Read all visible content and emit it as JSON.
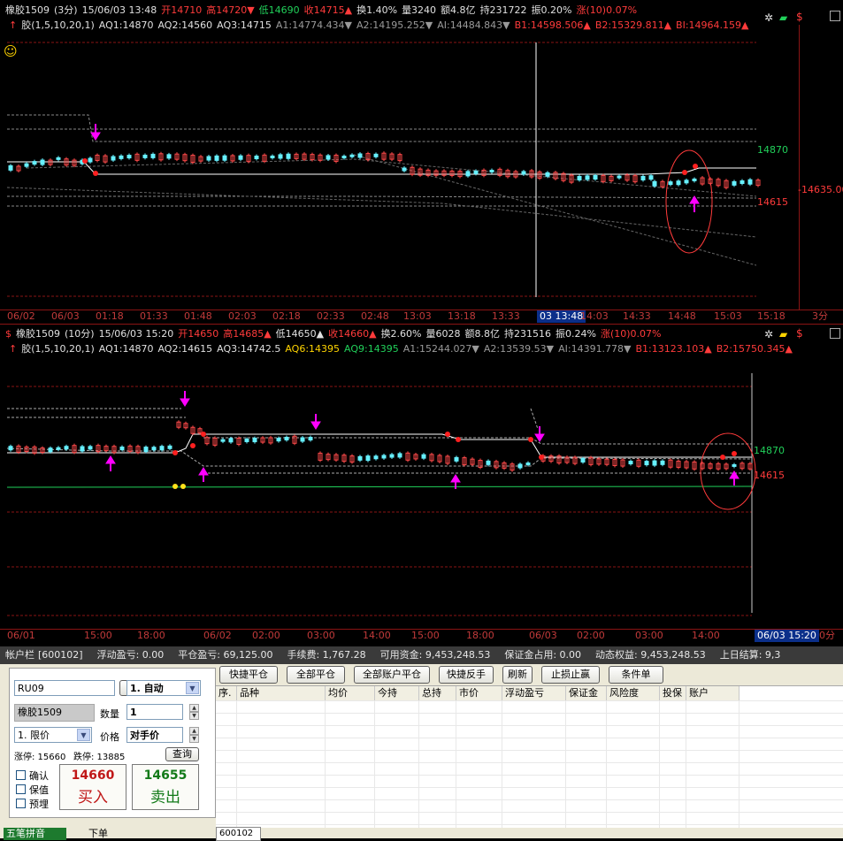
{
  "colors": {
    "up": "#ff3b3b",
    "down": "#5ff0ff",
    "bg": "#000000",
    "grid": "#8a1414",
    "accent": "#ff00ff"
  },
  "chart1": {
    "hdr": {
      "name": "橡胶1509",
      "period": "(3分)",
      "datetime": "15/06/03 13:48",
      "open": "开14710",
      "high": "高14720▼",
      "low": "低14690",
      "close": "收14715▲",
      "turnover": "换1.40%",
      "volume": "量3240",
      "amount": "额4.8亿",
      "position": "持231722",
      "amplitude": "振0.20%",
      "change": "涨(10)0.07%"
    },
    "ind": {
      "name": "胶(1,5,10,20,1)",
      "aq1": "AQ1:14870",
      "aq2": "AQ2:14560",
      "aq3": "AQ3:14715",
      "a1": "A1:14774.434▼",
      "a2": "A2:14195.252▼",
      "ai": "AI:14484.843▼",
      "b1": "B1:14598.506▲",
      "b2": "B2:15329.811▲",
      "bi": "BI:14964.159▲"
    },
    "labels": {
      "upper": "14870",
      "right": "-14635.00",
      "lower": "14615"
    },
    "xticks": [
      "06/02",
      "06/03",
      "01:18",
      "01:33",
      "01:48",
      "02:03",
      "02:18",
      "02:33",
      "02:48",
      "13:03",
      "13:18",
      "13:33",
      "03 13:48",
      "14:03",
      "14:33",
      "14:48",
      "15:03",
      "15:18"
    ],
    "period_tab": "3分"
  },
  "chart2": {
    "hdr": {
      "name": "橡胶1509",
      "period": "(10分)",
      "datetime": "15/06/03 15:20",
      "open": "开14650",
      "high": "高14685▲",
      "low": "低14650▲",
      "close": "收14660▲",
      "turnover": "换2.60%",
      "volume": "量6028",
      "amount": "额8.8亿",
      "position": "持231516",
      "amplitude": "振0.24%",
      "change": "涨(10)0.07%"
    },
    "ind": {
      "name": "胶(1,5,10,20,1)",
      "aq1": "AQ1:14870",
      "aq2": "AQ2:14615",
      "aq3": "AQ3:14742.5",
      "aq6": "AQ6:14395",
      "aq9": "AQ9:14395",
      "a1": "A1:15244.027▼",
      "a2": "A2:13539.53▼",
      "ai": "AI:14391.778▼",
      "b1": "B1:13123.103▲",
      "b2": "B2:15750.345▲"
    },
    "labels": {
      "upper": "14870",
      "lower": "14615"
    },
    "xticks": [
      "06/01",
      "15:00",
      "18:00",
      "06/02",
      "02:00",
      "03:00",
      "14:00",
      "15:00",
      "18:00",
      "06/03",
      "02:00",
      "03:00",
      "14:00",
      "06/03 15:20"
    ],
    "period_tab": "0分"
  },
  "account": {
    "label": "帐户栏",
    "id": "[600102]",
    "float_pl": "浮动盈亏: 0.00",
    "close_pl": "平仓盈亏: 69,125.00",
    "fee": "手续费: 1,767.28",
    "available": "可用资金: 9,453,248.53",
    "margin": "保证金占用: 0.00",
    "equity": "动态权益: 9,453,248.53",
    "settle": "上日结算: 9,3"
  },
  "order": {
    "code": "RU09",
    "code_btn": "..",
    "mode": "1. 自动",
    "name": "橡胶1509",
    "qty_label": "数量",
    "qty": "1",
    "price_type": "1. 限价",
    "price_label": "价格",
    "price": "对手价",
    "limit_up": "涨停: 15660",
    "limit_down": "跌停: 13885",
    "query_btn": "查询",
    "cb_confirm": "确认",
    "cb_keep": "保值",
    "cb_pre": "预埋",
    "buy_price": "14660",
    "buy_label": "买入",
    "sell_price": "14655",
    "sell_label": "卖出"
  },
  "toolbar": [
    "快捷平仓",
    "全部平仓",
    "全部账户平仓",
    "快捷反手",
    "刷新",
    "止损止赢",
    "条件单"
  ],
  "grid_headers": [
    "序.",
    "品种",
    "均价",
    "今持",
    "总持",
    "市价",
    "浮动盈亏",
    "保证金",
    "风险度",
    "投保",
    "账户"
  ],
  "bottom_tabs": {
    "t1": "五笔拼音",
    "t2": "下单",
    "t3": "600102"
  }
}
